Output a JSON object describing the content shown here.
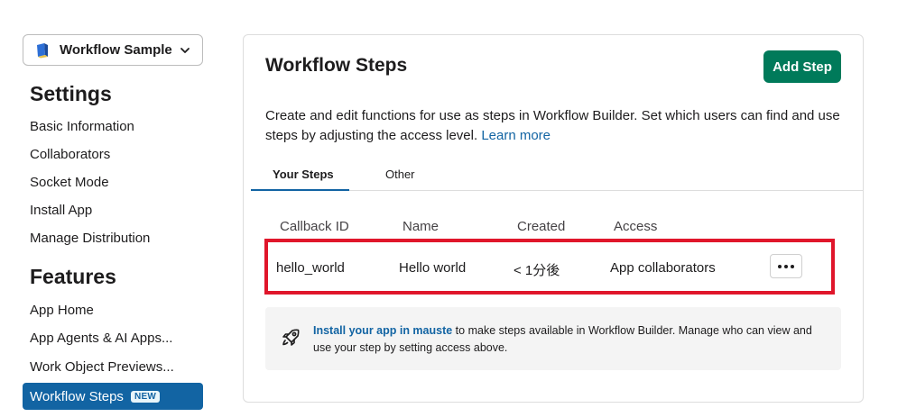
{
  "sidebar": {
    "app_name": "Workflow Sample",
    "settings_title": "Settings",
    "settings_items": [
      "Basic Information",
      "Collaborators",
      "Socket Mode",
      "Install App",
      "Manage Distribution"
    ],
    "features_title": "Features",
    "features_items": [
      "App Home",
      "App Agents & AI Apps...",
      "Work Object Previews..."
    ],
    "active_item": "Workflow Steps",
    "active_badge": "NEW"
  },
  "main": {
    "title": "Workflow Steps",
    "add_button": "Add Step",
    "description": "Create and edit functions for use as steps in Workflow Builder. Set which users can find and use steps by adjusting the access level.",
    "learn_more": "Learn more",
    "tabs": [
      "Your Steps",
      "Other"
    ],
    "table": {
      "headers": [
        "Callback ID",
        "Name",
        "Created",
        "Access"
      ],
      "rows": [
        {
          "callback_id": "hello_world",
          "name": "Hello world",
          "created": "< 1分後",
          "access": "App collaborators"
        }
      ]
    },
    "info": {
      "link": "Install your app in mauste",
      "text": " to make steps available in Workflow Builder. Manage who can view and use your step by setting access above."
    }
  },
  "colors": {
    "accent": "#1264a3",
    "add_button": "#007a5a",
    "highlight": "#e0162b"
  }
}
